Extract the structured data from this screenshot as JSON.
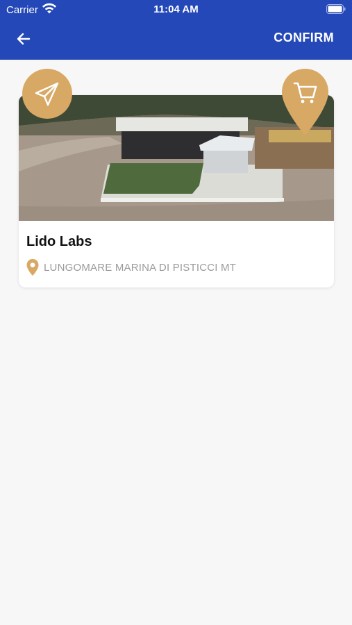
{
  "status_bar": {
    "carrier": "Carrier",
    "time": "11:04 AM"
  },
  "header": {
    "confirm_label": "CONFIRM",
    "back_icon": "arrow-left-icon"
  },
  "colors": {
    "header_bg": "#2448b8",
    "accent": "#d8a865",
    "address_text": "#9b9b9b",
    "background": "#f7f7f7"
  },
  "card": {
    "title": "Lido Labs",
    "address": "LUNGOMARE MARINA DI PISTICCI MT",
    "address_icon": "location-pin-icon",
    "share_icon": "paper-plane-icon",
    "cart_icon": "shopping-cart-icon"
  }
}
